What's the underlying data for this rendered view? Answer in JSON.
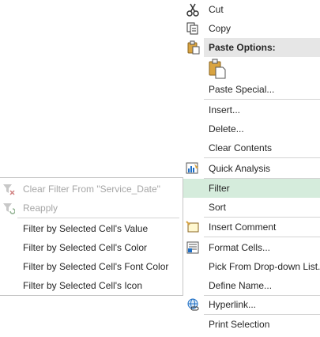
{
  "context_menu": {
    "items": [
      {
        "label": "Cut",
        "icon": "scissors-icon"
      },
      {
        "label": "Copy",
        "icon": "copy-icon"
      },
      {
        "label": "Paste Options:",
        "icon": "paste-icon"
      },
      {
        "label": "Paste Special...",
        "icon": ""
      },
      {
        "label": "Insert...",
        "icon": ""
      },
      {
        "label": "Delete...",
        "icon": ""
      },
      {
        "label": "Clear Contents",
        "icon": ""
      },
      {
        "label": "Quick Analysis",
        "icon": "quick-analysis-icon"
      },
      {
        "label": "Filter",
        "icon": "",
        "highlighted": true
      },
      {
        "label": "Sort",
        "icon": ""
      },
      {
        "label": "Insert Comment",
        "icon": "comment-icon"
      },
      {
        "label": "Format Cells...",
        "icon": "format-cells-icon"
      },
      {
        "label": "Pick From Drop-down List...",
        "icon": ""
      },
      {
        "label": "Define Name...",
        "icon": ""
      },
      {
        "label": "Hyperlink...",
        "icon": "hyperlink-icon"
      },
      {
        "label": "Print Selection",
        "icon": ""
      }
    ]
  },
  "filter_submenu": {
    "items": [
      {
        "label": "Clear Filter From \"Service_Date\"",
        "disabled": true,
        "icon": "clear-filter-icon"
      },
      {
        "label": "Reapply",
        "disabled": true,
        "icon": "reapply-filter-icon"
      },
      {
        "label": "Filter by Selected Cell's Value",
        "disabled": false
      },
      {
        "label": "Filter by Selected Cell's Color",
        "disabled": false
      },
      {
        "label": "Filter by Selected Cell's Font Color",
        "disabled": false
      },
      {
        "label": "Filter by Selected Cell's Icon",
        "disabled": false
      }
    ]
  },
  "colors": {
    "highlight": "#d5ecdc",
    "header_bg": "#e6e6e6",
    "disabled_text": "#a6a6a6"
  }
}
